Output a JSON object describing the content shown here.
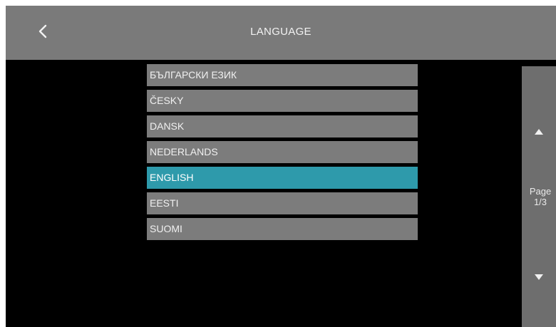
{
  "header": {
    "title": "LANGUAGE",
    "back_icon": "chevron-left-icon"
  },
  "languages": [
    {
      "label": "БЪЛГАРСКИ ЕЗИК",
      "selected": false
    },
    {
      "label": "ČESKY",
      "selected": false
    },
    {
      "label": "DANSK",
      "selected": false
    },
    {
      "label": "NEDERLANDS",
      "selected": false
    },
    {
      "label": "ENGLISH",
      "selected": true
    },
    {
      "label": "EESTI",
      "selected": false
    },
    {
      "label": "SUOMI",
      "selected": false
    }
  ],
  "pager": {
    "label": "Page",
    "current": "1/3",
    "up_icon": "triangle-up-icon",
    "down_icon": "triangle-down-icon"
  },
  "colors": {
    "header_bg": "#7a7a7a",
    "item_bg": "#7c7c7c",
    "selected_bg": "#2e9aab",
    "screen_bg": "#000000",
    "side_panel_bg": "#6e6e6e"
  }
}
